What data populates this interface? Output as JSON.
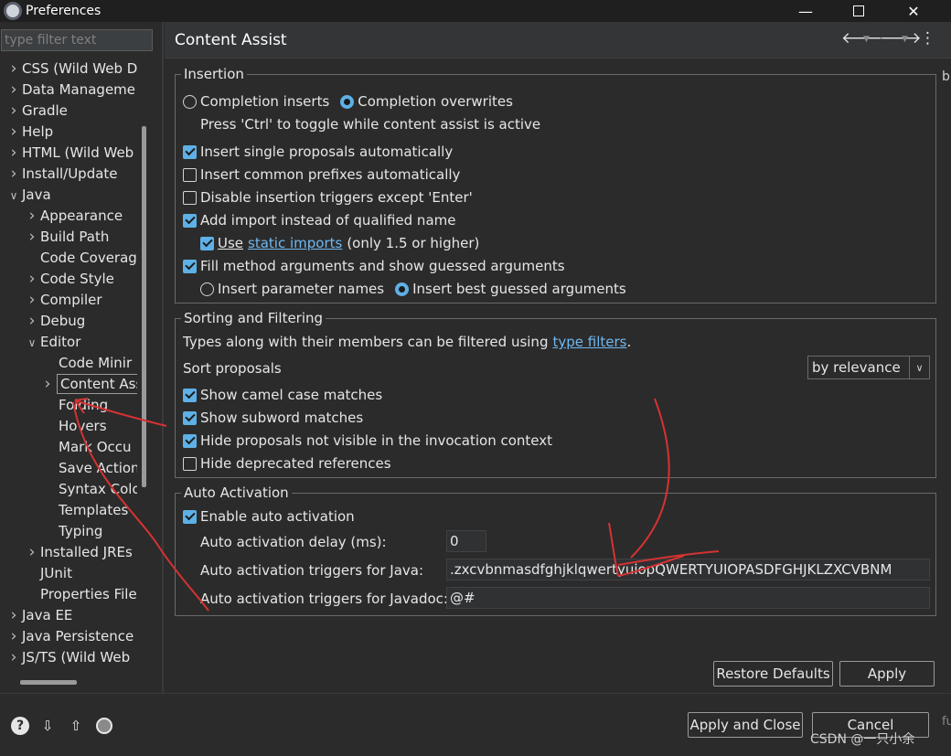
{
  "window": {
    "title": "Preferences",
    "minimize_glyph": "—",
    "close_glyph": "✕"
  },
  "filter": {
    "placeholder": "type filter text"
  },
  "tree": {
    "items": [
      {
        "label": "CSS (Wild Web D",
        "level": 0,
        "state": "collapsed"
      },
      {
        "label": "Data Manageme",
        "level": 0,
        "state": "collapsed"
      },
      {
        "label": "Gradle",
        "level": 0,
        "state": "collapsed"
      },
      {
        "label": "Help",
        "level": 0,
        "state": "collapsed"
      },
      {
        "label": "HTML (Wild Web",
        "level": 0,
        "state": "collapsed"
      },
      {
        "label": "Install/Update",
        "level": 0,
        "state": "collapsed"
      },
      {
        "label": "Java",
        "level": 0,
        "state": "expanded"
      },
      {
        "label": "Appearance",
        "level": 1,
        "state": "collapsed"
      },
      {
        "label": "Build Path",
        "level": 1,
        "state": "collapsed"
      },
      {
        "label": "Code Coverag",
        "level": 1,
        "state": "leaf"
      },
      {
        "label": "Code Style",
        "level": 1,
        "state": "collapsed"
      },
      {
        "label": "Compiler",
        "level": 1,
        "state": "collapsed"
      },
      {
        "label": "Debug",
        "level": 1,
        "state": "collapsed"
      },
      {
        "label": "Editor",
        "level": 1,
        "state": "expanded"
      },
      {
        "label": "Code Minir",
        "level": 2,
        "state": "leaf"
      },
      {
        "label": "Content Assist",
        "level": 2,
        "state": "collapsed",
        "selected": true
      },
      {
        "label": "Folding",
        "level": 2,
        "state": "leaf"
      },
      {
        "label": "Hovers",
        "level": 2,
        "state": "leaf"
      },
      {
        "label": "Mark Occu",
        "level": 2,
        "state": "leaf"
      },
      {
        "label": "Save Action",
        "level": 2,
        "state": "leaf"
      },
      {
        "label": "Syntax Colo",
        "level": 2,
        "state": "leaf"
      },
      {
        "label": "Templates",
        "level": 2,
        "state": "leaf"
      },
      {
        "label": "Typing",
        "level": 2,
        "state": "leaf"
      },
      {
        "label": "Installed JREs",
        "level": 1,
        "state": "collapsed"
      },
      {
        "label": "JUnit",
        "level": 1,
        "state": "leaf"
      },
      {
        "label": "Properties File",
        "level": 1,
        "state": "leaf"
      },
      {
        "label": "Java EE",
        "level": 0,
        "state": "collapsed"
      },
      {
        "label": "Java Persistence",
        "level": 0,
        "state": "collapsed"
      },
      {
        "label": "JS/TS (Wild Web",
        "level": 0,
        "state": "collapsed"
      }
    ]
  },
  "page": {
    "title": "Content Assist",
    "nav": {
      "back": "🡐",
      "forward": "🡒",
      "dropdown": "▼",
      "menu": "⋮"
    }
  },
  "insertion": {
    "legend": "Insertion",
    "radio_inserts": "Completion inserts",
    "radio_overwrites": "Completion overwrites",
    "hint": "Press 'Ctrl' to toggle while content assist is active",
    "single_proposals": "Insert single proposals automatically",
    "common_prefixes": "Insert common prefixes automatically",
    "disable_triggers": "Disable insertion triggers except 'Enter'",
    "add_import": "Add import instead of qualified name",
    "use_label": "Use",
    "static_imports_link": "static imports",
    "use_suffix": "(only 1.5 or higher)",
    "fill_args": "Fill method arguments and show guessed arguments",
    "param_names": "Insert parameter names",
    "best_guessed": "Insert best guessed arguments"
  },
  "sorting": {
    "legend": "Sorting and Filtering",
    "desc_prefix": "Types along with their members can be filtered using",
    "type_filters_link": "type filters",
    "desc_suffix": ".",
    "sort_label": "Sort proposals",
    "sort_value": "by relevance",
    "camel": "Show camel case matches",
    "subword": "Show subword matches",
    "hide_invisible": "Hide proposals not visible in the invocation context",
    "hide_deprecated": "Hide deprecated references"
  },
  "auto": {
    "legend": "Auto Activation",
    "enable": "Enable auto activation",
    "delay_label": "Auto activation delay (ms):",
    "delay_value": "0",
    "java_label": "Auto activation triggers for Java:",
    "java_value": ".zxcvbnmasdfghjklqwertyuiopQWERTYUIOPASDFGHJKLZXCVBNM",
    "javadoc_label": "Auto activation triggers for Javadoc:",
    "javadoc_value": "@#"
  },
  "buttons": {
    "restore": "Restore Defaults",
    "apply": "Apply",
    "apply_close": "Apply and Close",
    "cancel": "Cancel"
  },
  "bottom_icons": {
    "help": "?",
    "import": "⇩",
    "export": "⇧"
  },
  "watermark": "CSDN @一只小余",
  "edge_chars": {
    "top": "b",
    "bottom": "fu"
  },
  "colors": {
    "accent": "#5fb0e6",
    "link": "#6fb8f0",
    "annotation": "#d63232"
  }
}
